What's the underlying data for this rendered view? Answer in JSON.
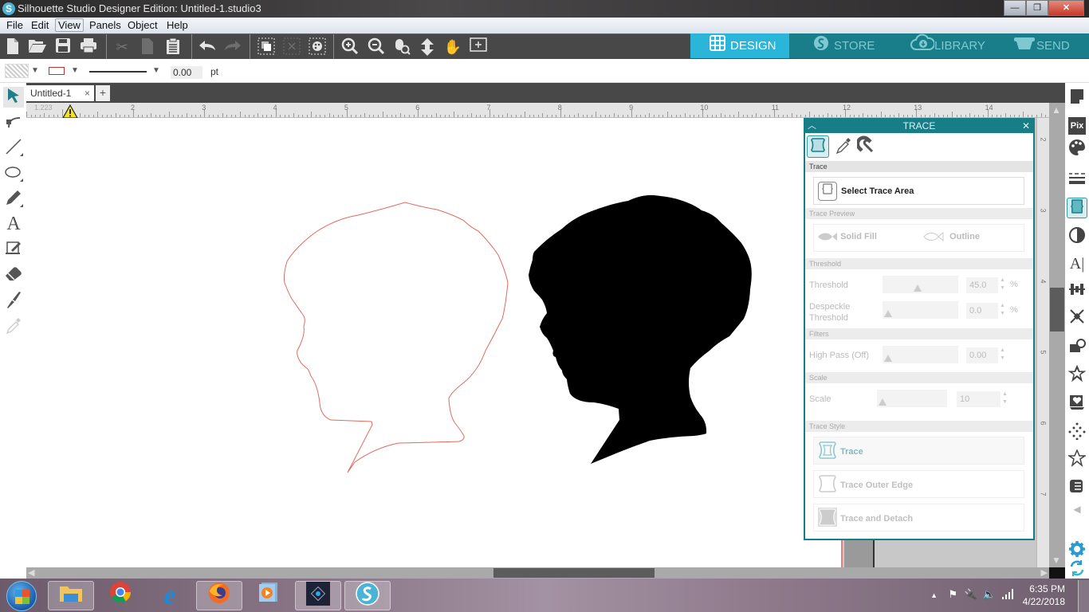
{
  "window": {
    "title": "Silhouette Studio Designer Edition: Untitled-1.studio3",
    "controls": {
      "minimize": "—",
      "restore": "❐",
      "close": "✕"
    }
  },
  "menu": [
    "File",
    "Edit",
    "View",
    "Panels",
    "Object",
    "Help"
  ],
  "menu_active": "View",
  "toolbar": {
    "icons": [
      "new-document-icon",
      "open-folder-icon",
      "save-icon",
      "print-icon",
      "cut-icon",
      "copy-icon",
      "paste-icon",
      "undo-icon",
      "redo-icon",
      "group-icon",
      "ungroup-icon",
      "compound-path-icon",
      "zoom-in-icon",
      "zoom-out-icon",
      "zoom-selection-icon",
      "fit-to-page-icon",
      "pan-hand-icon",
      "fit-to-window-icon"
    ]
  },
  "mode_tabs": [
    {
      "label": "DESIGN",
      "icon": "grid-icon",
      "active": true
    },
    {
      "label": "STORE",
      "icon": "silhouette-s-icon",
      "active": false
    },
    {
      "label": "LIBRARY",
      "icon": "cloud-download-icon",
      "active": false
    },
    {
      "label": "SEND",
      "icon": "cutter-icon",
      "active": false
    }
  ],
  "properties": {
    "line_width": "0.00",
    "line_unit": "pt",
    "line_color": "#b33333"
  },
  "document_tab": {
    "label": "Untitled-1",
    "close": "×",
    "add": "+"
  },
  "ruler": {
    "corner_readout": "1.223",
    "horizontal_labels": [
      "2",
      "3",
      "4",
      "5",
      "6",
      "7",
      "8",
      "9",
      "10",
      "11",
      "12",
      "13",
      "14"
    ],
    "vertical_labels": [
      "2",
      "3",
      "4",
      "5",
      "6",
      "7"
    ]
  },
  "canvas": {
    "outline_color": "#e06b5f",
    "fill_color": "#000000"
  },
  "trace_panel": {
    "title": "TRACE",
    "sections": {
      "trace": "Trace",
      "trace_preview": "Trace Preview",
      "threshold": "Threshold",
      "filters": "Filters",
      "scale": "Scale",
      "trace_style": "Trace Style"
    },
    "select_trace_area": "Select Trace Area",
    "preview": {
      "solid_fill": "Solid Fill",
      "outline": "Outline"
    },
    "threshold": {
      "label": "Threshold",
      "value": "45.0",
      "unit": "%",
      "fraction": 0.45
    },
    "despeckle": {
      "label": "Despeckle Threshold",
      "label_line1": "Despeckle",
      "label_line2": "Threshold",
      "value": "0.0",
      "unit": "%",
      "fraction": 0.0
    },
    "high_pass": {
      "label": "High Pass (Off)",
      "value": "0.00",
      "fraction": 0.0
    },
    "scale": {
      "label": "Scale",
      "value": "10",
      "fraction": 0.0
    },
    "styles": [
      "Trace",
      "Trace Outer Edge",
      "Trace and Detach"
    ]
  },
  "right_panel": {
    "icons": [
      "page-setup-icon",
      "pixscan-icon",
      "fill-color-icon",
      "line-style-icon",
      "trace-icon",
      "contrast-icon",
      "text-style-icon",
      "align-icon",
      "transform-icon",
      "replicate-icon",
      "offset-icon",
      "modify-icon",
      "sketch-icon",
      "star-icon",
      "library-icon",
      "collapse-icon",
      "settings-icon",
      "sync-icon"
    ],
    "pix_label": "Pix",
    "text_label": "A|"
  },
  "taskbar": {
    "apps": [
      "file-explorer-icon",
      "chrome-icon",
      "internet-explorer-icon",
      "firefox-icon",
      "media-player-icon",
      "photoshop-elements-icon",
      "silhouette-studio-icon"
    ],
    "time": "6:35 PM",
    "date": "4/22/2018"
  }
}
